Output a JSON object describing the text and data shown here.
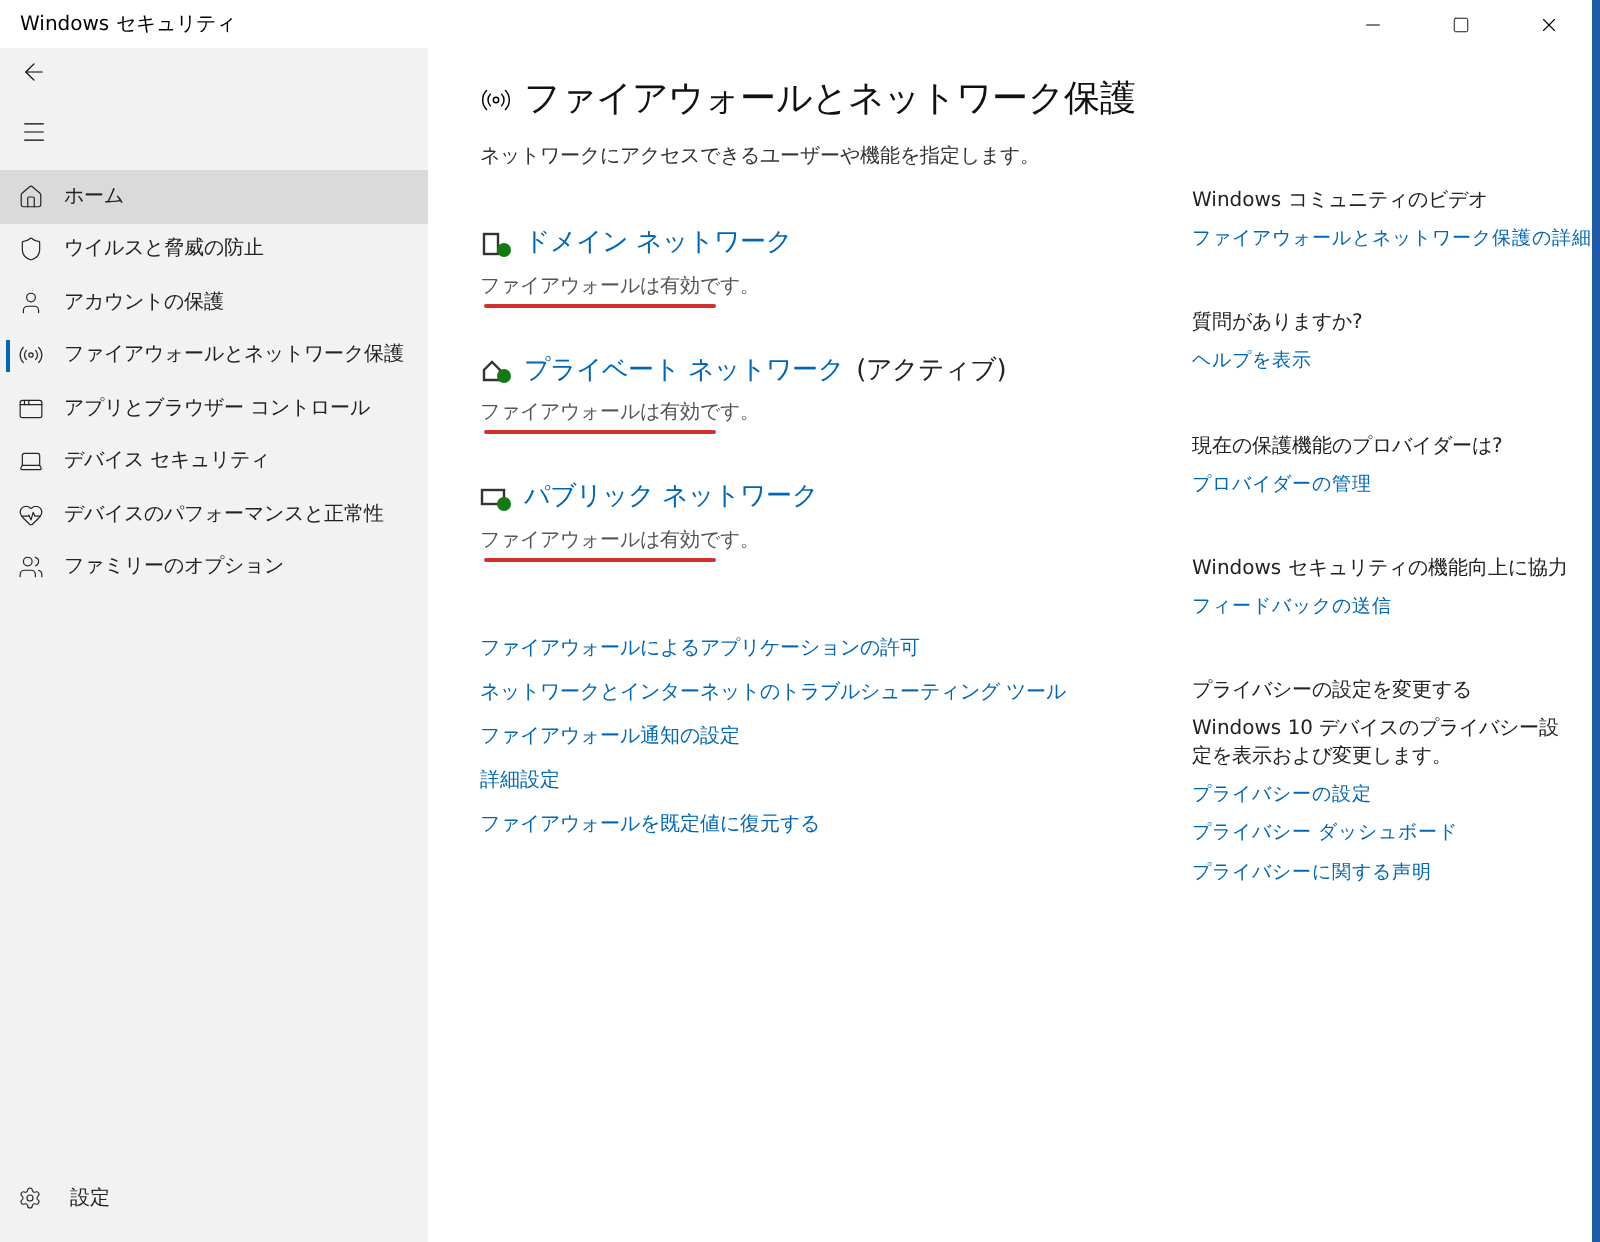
{
  "window": {
    "title": "Windows セキュリティ"
  },
  "sidebar": {
    "items": [
      {
        "label": "ホーム",
        "selected": true,
        "current": false
      },
      {
        "label": "ウイルスと脅威の防止",
        "selected": false,
        "current": false
      },
      {
        "label": "アカウントの保護",
        "selected": false,
        "current": false
      },
      {
        "label": "ファイアウォールとネットワーク保護",
        "selected": false,
        "current": true
      },
      {
        "label": "アプリとブラウザー コントロール",
        "selected": false,
        "current": false
      },
      {
        "label": "デバイス セキュリティ",
        "selected": false,
        "current": false
      },
      {
        "label": "デバイスのパフォーマンスと正常性",
        "selected": false,
        "current": false
      },
      {
        "label": "ファミリーのオプション",
        "selected": false,
        "current": false
      }
    ],
    "settings": "設定"
  },
  "page": {
    "title": "ファイアウォールとネットワーク保護",
    "subtitle": "ネットワークにアクセスできるユーザーや機能を指定します。",
    "networks": [
      {
        "kind": "domain",
        "name": "ドメイン ネットワーク",
        "status": "ファイアウォールは有効です。",
        "underlined": true
      },
      {
        "kind": "private",
        "name": "プライベート ネットワーク",
        "suffix": "(アクティブ)",
        "status": "ファイアウォールは有効です。",
        "underlined": true
      },
      {
        "kind": "public",
        "name": "パブリック ネットワーク",
        "status": "ファイアウォールは有効です。",
        "underlined": true
      }
    ],
    "links": [
      "ファイアウォールによるアプリケーションの許可",
      "ネットワークとインターネットのトラブルシューティング ツール",
      "ファイアウォール通知の設定",
      "詳細設定",
      "ファイアウォールを既定値に復元する"
    ]
  },
  "aside": [
    {
      "heading": "Windows コミュニティのビデオ",
      "links": [
        "ファイアウォールとネットワーク保護の詳細"
      ]
    },
    {
      "heading": "質問がありますか?",
      "links": [
        "ヘルプを表示"
      ]
    },
    {
      "heading": "現在の保護機能のプロバイダーは?",
      "links": [
        "プロバイダーの管理"
      ]
    },
    {
      "heading": "Windows セキュリティの機能向上に協力",
      "links": [
        "フィードバックの送信"
      ]
    },
    {
      "heading": "プライバシーの設定を変更する",
      "text": "Windows 10 デバイスのプライバシー設定を表示および変更します。",
      "links": [
        "プライバシーの設定",
        "プライバシー ダッシュボード",
        "プライバシーに関する声明"
      ]
    }
  ]
}
